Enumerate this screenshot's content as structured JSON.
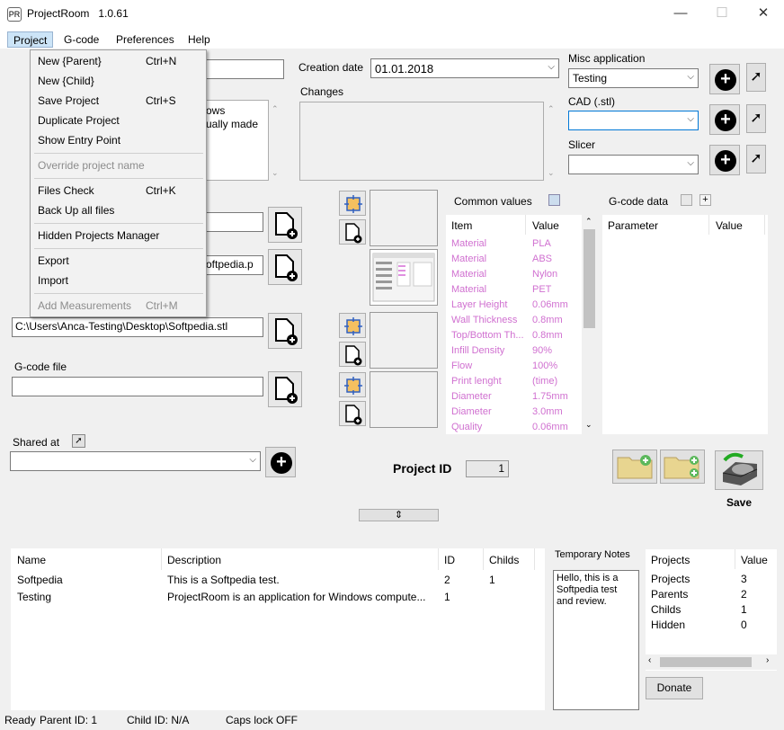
{
  "window": {
    "title": "ProjectRoom",
    "version": "1.0.61",
    "icon_text": "PR",
    "minimize": "—",
    "maximize": "☐",
    "close": "✕"
  },
  "menubar": [
    "Project",
    "G-code",
    "Preferences",
    "Help"
  ],
  "project_menu": [
    {
      "label": "New {Parent}",
      "shortcut": "Ctrl+N",
      "enabled": true
    },
    {
      "label": "New {Child}",
      "shortcut": "",
      "enabled": true
    },
    {
      "label": "Save Project",
      "shortcut": "Ctrl+S",
      "enabled": true
    },
    {
      "label": "Duplicate Project",
      "shortcut": "",
      "enabled": true
    },
    {
      "label": "Show Entry Point",
      "shortcut": "",
      "enabled": true
    },
    {
      "label": "Override project name",
      "shortcut": "",
      "enabled": false
    },
    {
      "label": "Files Check",
      "shortcut": "Ctrl+K",
      "enabled": true
    },
    {
      "label": "Back Up all files",
      "shortcut": "",
      "enabled": true
    },
    {
      "label": "Hidden Projects Manager",
      "shortcut": "",
      "enabled": true
    },
    {
      "label": "Export",
      "shortcut": "",
      "enabled": true
    },
    {
      "label": "Import",
      "shortcut": "",
      "enabled": true
    },
    {
      "label": "Add Measurements",
      "shortcut": "Ctrl+M",
      "enabled": false
    }
  ],
  "creation_date": {
    "label": "Creation date",
    "value": "01.01.2018"
  },
  "changes": {
    "label": "Changes"
  },
  "description_fragment": {
    "line1": "ows",
    "line2": "ually made"
  },
  "misc_app": {
    "label": "Misc application",
    "value": "Testing"
  },
  "cad": {
    "label": "CAD (.stl)",
    "value": ""
  },
  "slicer": {
    "label": "Slicer",
    "value": ""
  },
  "file_fragment": "oftpedia.p",
  "stl_path": "C:\\Users\\Anca-Testing\\Desktop\\Softpedia.stl",
  "gcode_file": {
    "label": "G-code file",
    "value": ""
  },
  "shared_at": {
    "label": "Shared at",
    "value": ""
  },
  "common_values": {
    "title": "Common values",
    "headers": [
      "Item",
      "Value"
    ],
    "rows": [
      [
        "Material",
        "PLA"
      ],
      [
        "Material",
        "ABS"
      ],
      [
        "Material",
        "Nylon"
      ],
      [
        "Material",
        "PET"
      ],
      [
        "Layer Height",
        "0.06mm"
      ],
      [
        "Wall Thickness",
        "0.8mm"
      ],
      [
        "Top/Bottom Th...",
        "0.8mm"
      ],
      [
        "Infill Density",
        "90%"
      ],
      [
        "Flow",
        "100%"
      ],
      [
        "Print lenght",
        "(time)"
      ],
      [
        "Diameter",
        "1.75mm"
      ],
      [
        "Diameter",
        "3.0mm"
      ],
      [
        "Quality",
        "0.06mm"
      ]
    ]
  },
  "gcode_data": {
    "title": "G-code data",
    "headers": [
      "Parameter",
      "Value"
    ],
    "plus": "+"
  },
  "project_id": {
    "label": "Project ID",
    "value": "1"
  },
  "save": {
    "label": "Save"
  },
  "projects_table": {
    "headers": [
      "Name",
      "Description",
      "ID",
      "Childs"
    ],
    "rows": [
      [
        "Softpedia",
        "This is a Softpedia test.",
        "2",
        "1"
      ],
      [
        "Testing",
        "ProjectRoom is an application for Windows compute...",
        "1",
        ""
      ]
    ]
  },
  "temp_notes": {
    "label": "Temporary Notes",
    "text": "Hello, this is a Softpedia test and review."
  },
  "stats": {
    "headers": [
      "Projects",
      "Value"
    ],
    "rows": [
      [
        "Projects",
        "3"
      ],
      [
        "Parents",
        "2"
      ],
      [
        "Childs",
        "1"
      ],
      [
        "Hidden",
        "0"
      ]
    ]
  },
  "donate": {
    "label": "Donate"
  },
  "statusbar": {
    "ready": "Ready",
    "parent": "Parent ID: 1",
    "child": "Child ID: N/A",
    "caps": "Caps lock OFF"
  },
  "icons": {
    "add": "plus-circle-icon",
    "open": "arrow-up-right-icon",
    "doc": "document-add-icon",
    "resize": "move-icon"
  }
}
